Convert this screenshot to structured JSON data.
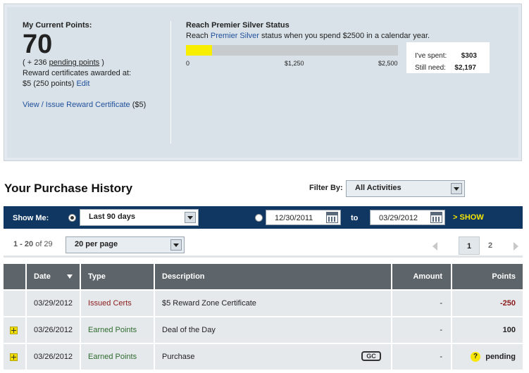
{
  "points": {
    "title": "My Current Points:",
    "value": "70",
    "pending_prefix": "( + 236 ",
    "pending_link": "pending points",
    "pending_suffix": " )",
    "certs_awarded": "Reward certificates awarded at:",
    "cert_rate": "$5 (250 points)",
    "edit_link": "Edit",
    "view_link": "View / Issue Reward Certificate",
    "view_suffix": "($5)"
  },
  "premier": {
    "title": "Reach Premier Silver Status",
    "sub_prefix": "Reach ",
    "sub_link": "Premier Silver",
    "sub_suffix": " status when you spend $2500 in a calendar year.",
    "progress_value": 303,
    "progress_max": 2500,
    "ticks": [
      "0",
      "$1,250",
      "$2,500"
    ],
    "spent_label": "I've spent:",
    "spent_value": "$303",
    "need_label": "Still need:",
    "need_value": "$2,197"
  },
  "history": {
    "title": "Your Purchase History",
    "filter_label": "Filter By:",
    "filter_value": "All Activities"
  },
  "show_bar": {
    "label": "Show Me:",
    "range_value": "Last 90 days",
    "date_from": "12/30/2011",
    "to_label": "to",
    "date_to": "03/29/2012",
    "show_button": "> SHOW"
  },
  "pagination": {
    "range": "1 - 20",
    "of": " of 29",
    "per_page": "20 per page",
    "pages": [
      "1",
      "2"
    ]
  },
  "table": {
    "headers": {
      "date": "Date",
      "type": "Type",
      "description": "Description",
      "amount": "Amount",
      "points": "Points"
    },
    "rows": [
      {
        "date": "03/29/2012",
        "type": "Issued Certs",
        "description": "$5 Reward Zone Certificate",
        "amount": "-",
        "points": "-250"
      },
      {
        "date": "03/26/2012",
        "type": "Earned Points",
        "description": "Deal of the Day",
        "amount": "-",
        "points": "100"
      },
      {
        "date": "03/26/2012",
        "type": "Earned Points",
        "description": "Purchase",
        "amount": "-",
        "points": "pending",
        "badge": "GC"
      }
    ]
  },
  "colors": {
    "nav_blue": "#0f3762",
    "progress_yellow": "#f7ee00",
    "issued_red": "#8b1a1a",
    "earned_green": "#2f6b2f"
  }
}
